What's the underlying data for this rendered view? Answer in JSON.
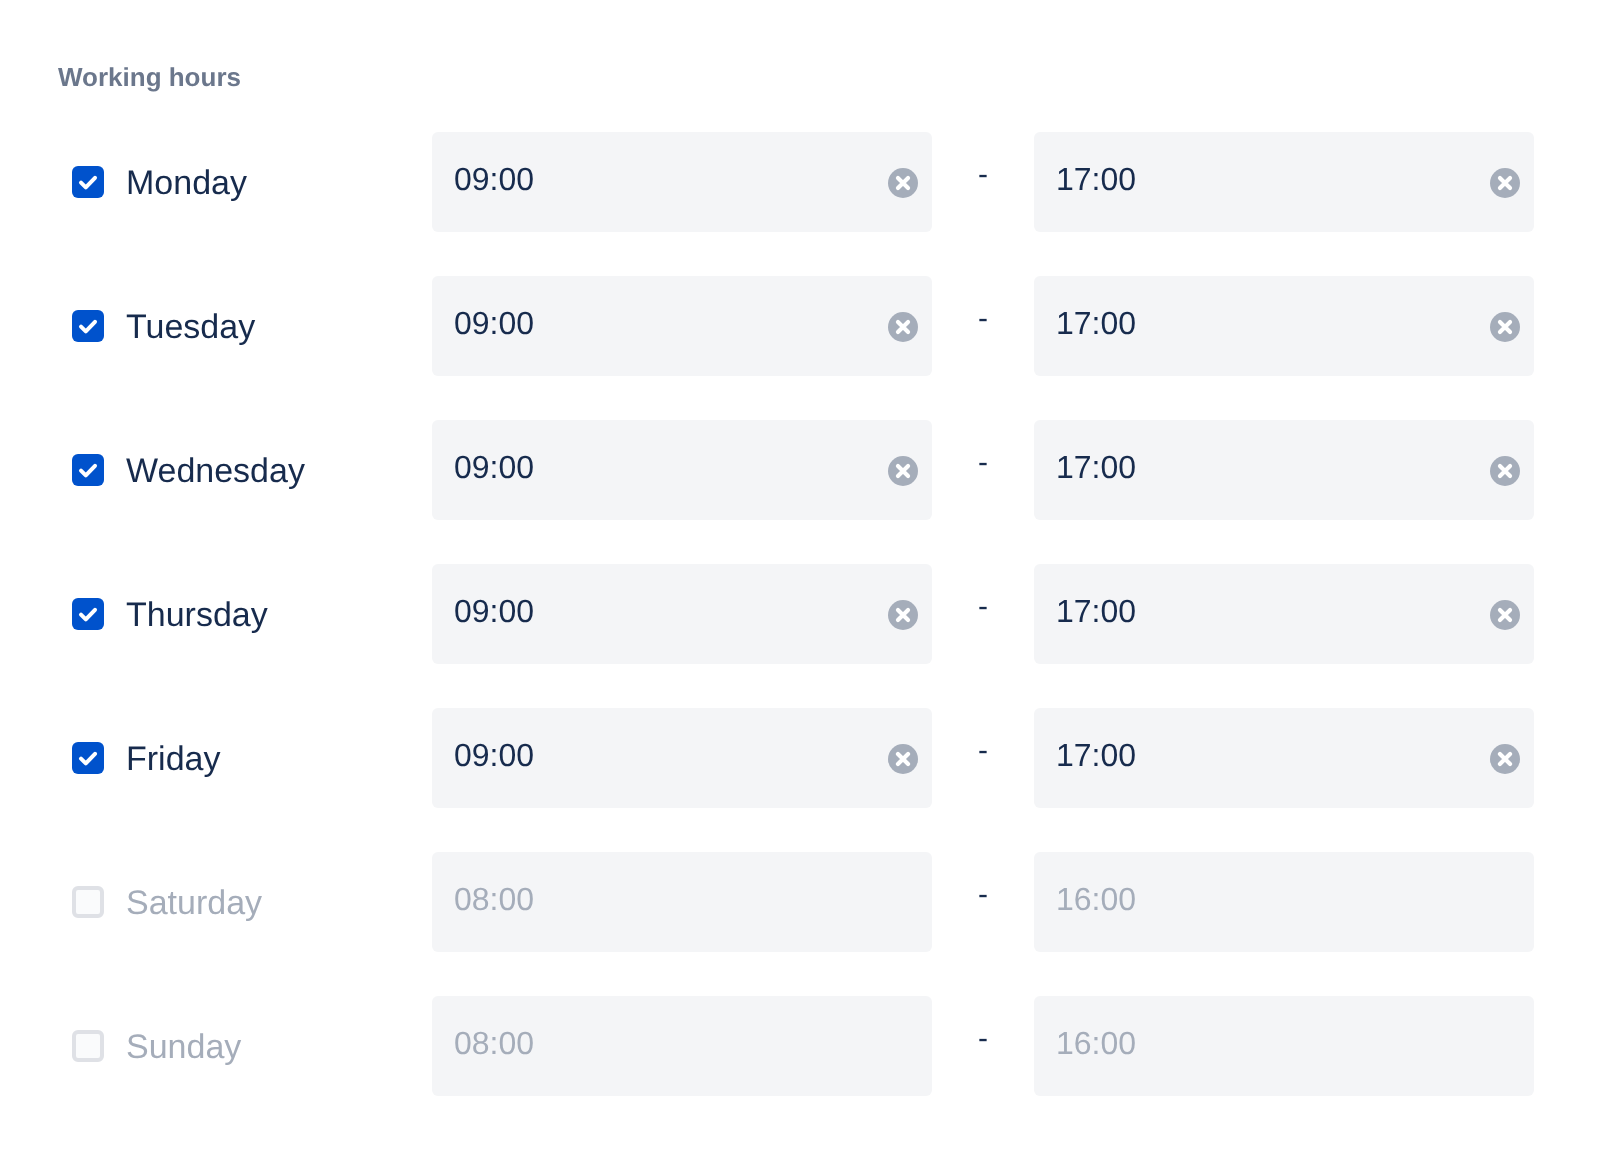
{
  "section_title": "Working hours",
  "days": [
    {
      "label": "Monday",
      "checked": true,
      "start": "09:00",
      "end": "17:00"
    },
    {
      "label": "Tuesday",
      "checked": true,
      "start": "09:00",
      "end": "17:00"
    },
    {
      "label": "Wednesday",
      "checked": true,
      "start": "09:00",
      "end": "17:00"
    },
    {
      "label": "Thursday",
      "checked": true,
      "start": "09:00",
      "end": "17:00"
    },
    {
      "label": "Friday",
      "checked": true,
      "start": "09:00",
      "end": "17:00"
    },
    {
      "label": "Saturday",
      "checked": false,
      "start": "08:00",
      "end": "16:00"
    },
    {
      "label": "Sunday",
      "checked": false,
      "start": "08:00",
      "end": "16:00"
    }
  ],
  "separator": "-"
}
